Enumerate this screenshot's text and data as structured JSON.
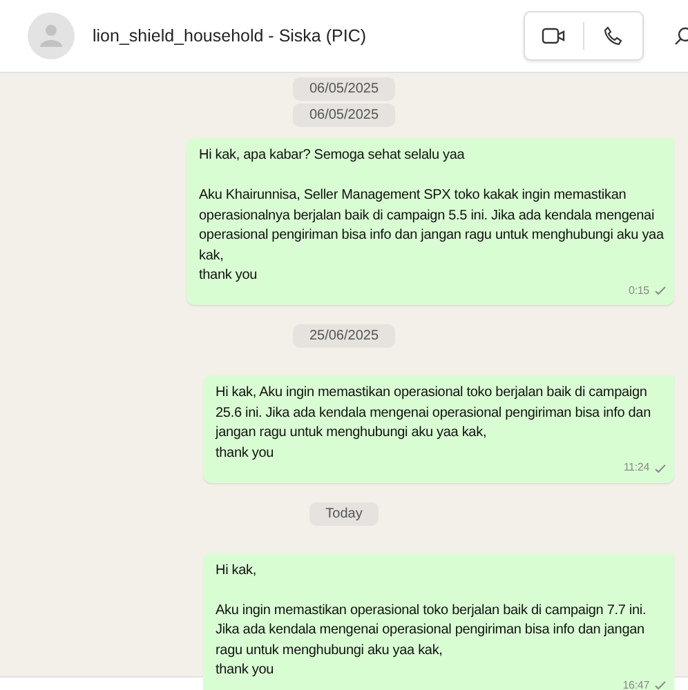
{
  "header": {
    "title": "lion_shield_household - Siska (PIC)"
  },
  "items": [
    {
      "kind": "date",
      "text": "06/05/2025"
    },
    {
      "kind": "date",
      "text": "06/05/2025"
    },
    {
      "kind": "message",
      "paragraphs": [
        "Hi kak, apa kabar? Semoga sehat selalu yaa",
        "Aku Khairunnisa, Seller Management SPX toko kakak ingin memastikan operasionalnya berjalan baik di campaign 5.5 ini. Jika ada kendala mengenai operasional pengiriman bisa info dan jangan ragu untuk menghubungi aku yaa kak,\nthank you"
      ],
      "time": "0:15"
    },
    {
      "kind": "date",
      "text": "25/06/2025"
    },
    {
      "kind": "message",
      "paragraphs": [
        "Hi kak, Aku ingin memastikan operasional toko berjalan baik di campaign 25.6 ini. Jika ada kendala mengenai operasional pengiriman bisa info dan jangan ragu untuk menghubungi aku yaa kak,\nthank you"
      ],
      "time": "11:24"
    },
    {
      "kind": "date",
      "text": "Today"
    },
    {
      "kind": "message",
      "paragraphs": [
        "Hi kak,",
        "Aku ingin memastikan operasional toko berjalan baik di campaign 7.7 ini. Jika ada kendala mengenai operasional pengiriman bisa info dan jangan ragu untuk menghubungi aku yaa kak,\nthank you"
      ],
      "time": "16:47"
    }
  ]
}
